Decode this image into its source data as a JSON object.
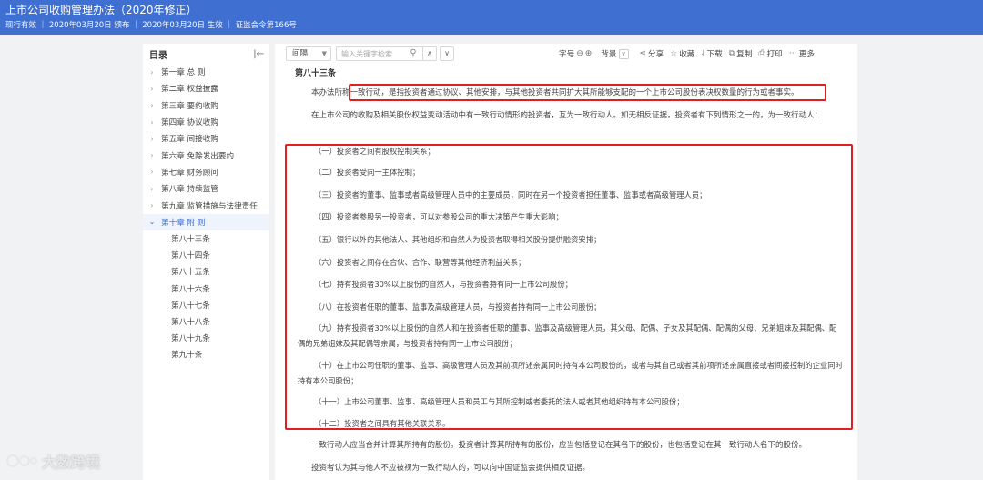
{
  "header": {
    "title": "上市公司收购管理办法（2020年修正）",
    "meta": "现行有效 ｜ 2020年03月20日 颁布 ｜ 2020年03月20日 生效 ｜ 证监会令第166号"
  },
  "sidebar": {
    "label": "目录",
    "chapters": [
      "第一章 总 则",
      "第二章 权益披露",
      "第三章 要约收购",
      "第四章 协议收购",
      "第五章 间接收购",
      "第六章 免除发出要约",
      "第七章 财务顾问",
      "第八章 持续监管",
      "第九章 监管措施与法律责任",
      "第十章 附 则"
    ],
    "articles": [
      "第八十三条",
      "第八十四条",
      "第八十五条",
      "第八十六条",
      "第八十七条",
      "第八十八条",
      "第八十九条",
      "第九十条"
    ]
  },
  "toolbar": {
    "select_value": "间隔",
    "search_placeholder": "输入关键字检索",
    "font_label": "字号",
    "bg_label": "背景",
    "share": "分享",
    "collect": "收藏",
    "download": "下载",
    "copy": "复制",
    "print": "打印",
    "more": "更多"
  },
  "content": {
    "article_title": "第八十三条",
    "intro_prefix": "本办法所称",
    "intro_boxed": "一致行动，是指投资者通过协议、其他安排，与其他投资者共同扩大其所能够支配的一个上市公司股份表决权数量的行为或者事实。",
    "para2": "在上市公司的收购及相关股份权益变动活动中有一致行动情形的投资者，互为一致行动人。如无相反证据，投资者有下列情形之一的，为一致行动人：",
    "items": [
      "（一）投资者之间有股权控制关系；",
      "（二）投资者受同一主体控制；",
      "（三）投资者的董事、监事或者高级管理人员中的主要成员，同时在另一个投资者担任董事、监事或者高级管理人员；",
      "（四）投资者参股另一投资者，可以对参股公司的重大决策产生重大影响；",
      "（五）银行以外的其他法人、其他组织和自然人为投资者取得相关股份提供融资安排；",
      "（六）投资者之间存在合伙、合作、联营等其他经济利益关系；",
      "（七）持有投资者30%以上股份的自然人，与投资者持有同一上市公司股份；",
      "（八）在投资者任职的董事、监事及高级管理人员，与投资者持有同一上市公司股份；",
      "（九）持有投资者30%以上股份的自然人和在投资者任职的董事、监事及高级管理人员，其父母、配偶、子女及其配偶、配偶的父母、兄弟姐妹及其配偶、配偶的兄弟姐妹及其配偶等亲属，与投资者持有同一上市公司股份；",
      "（十）在上市公司任职的董事、监事、高级管理人员及其前项所述亲属同时持有本公司股份的，或者与其自己或者其前项所述亲属直接或者间接控制的企业同时持有本公司股份；",
      "（十一）上市公司董事、监事、高级管理人员和员工与其所控制或者委托的法人或者其他组织持有本公司股份；",
      "（十二）投资者之间具有其他关联关系。"
    ],
    "para3": "一致行动人应当合并计算其所持有的股份。投资者计算其所持有的股份，应当包括登记在其名下的股份，也包括登记在其一致行动人名下的股份。",
    "para4": "投资者认为其与他人不应被视为一致行动人的，可以向中国证监会提供相反证据。"
  },
  "watermark": "大数跨境"
}
